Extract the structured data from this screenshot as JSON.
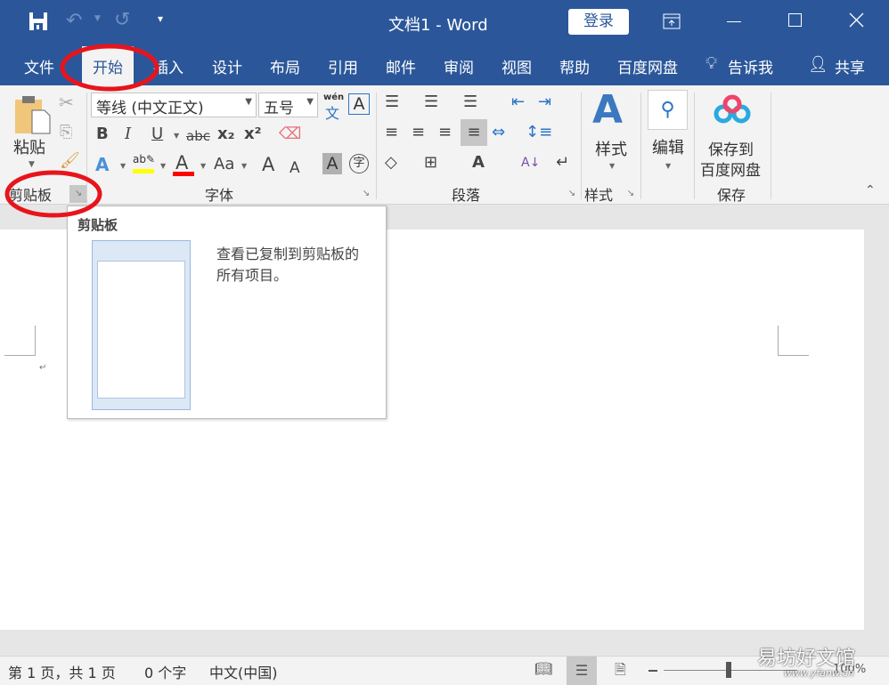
{
  "titlebar": {
    "title": "文档1  -  Word",
    "login": "登录",
    "icons": [
      "save-icon",
      "undo-icon",
      "redo-icon",
      "customize-qat-icon",
      "ribbon-display-icon",
      "minimize-icon",
      "maximize-icon",
      "close-icon"
    ]
  },
  "tabs": [
    {
      "label": "文件"
    },
    {
      "label": "开始",
      "active": true
    },
    {
      "label": "插入"
    },
    {
      "label": "设计"
    },
    {
      "label": "布局"
    },
    {
      "label": "引用"
    },
    {
      "label": "邮件"
    },
    {
      "label": "审阅"
    },
    {
      "label": "视图"
    },
    {
      "label": "帮助"
    },
    {
      "label": "百度网盘"
    }
  ],
  "tell_me": "告诉我",
  "share": "共享",
  "ribbon": {
    "clipboard": {
      "paste": "粘贴",
      "label": "剪贴板"
    },
    "font": {
      "font_name": "等线 (中文正文)",
      "font_size": "五号",
      "phonetic_top": "wén",
      "phonetic_bottom": "文",
      "label": "字体",
      "bold": "B",
      "italic": "I",
      "underline": "U",
      "strike": "abc",
      "sub": "x₂",
      "sup": "x²",
      "case": "Aa",
      "grow": "A",
      "shrink": "A",
      "shade": "A",
      "enclose": "字",
      "effect": "A",
      "color": "A",
      "border": "A"
    },
    "paragraph": {
      "label": "段落"
    },
    "styles": {
      "button": "样式",
      "label": "样式"
    },
    "editing": {
      "button": "编辑"
    },
    "save": {
      "button_line1": "保存到",
      "button_line2": "百度网盘",
      "label": "保存"
    }
  },
  "tooltip": {
    "title": "剪贴板",
    "description_line1": "查看已复制到剪贴板的",
    "description_line2": "所有项目。"
  },
  "status": {
    "page": "第 1 页，共 1 页",
    "words": "0 个字",
    "language": "中文(中国)",
    "zoom": "100%"
  },
  "watermark": {
    "text": "易坊好文馆",
    "url": "www.yfanw.cn"
  },
  "colors": {
    "brand": "#2b579a",
    "annotation": "#e8141c",
    "highlight": "#ffff00",
    "font_color": "#ff0000"
  }
}
